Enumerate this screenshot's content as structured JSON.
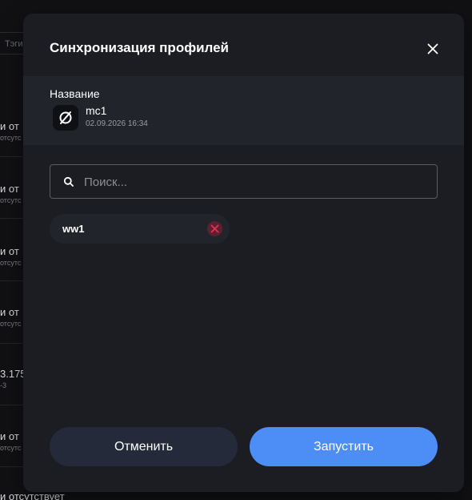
{
  "background": {
    "tags_label": "Тэги",
    "rows": [
      {
        "title": "и от",
        "subtitle": "отсутс"
      },
      {
        "title": "и от",
        "subtitle": "отсутс"
      },
      {
        "title": "и от",
        "subtitle": "отсутс"
      },
      {
        "title": "и от",
        "subtitle": "отсутс"
      },
      {
        "title": "3.175.",
        "subtitle": "-3"
      },
      {
        "title": "и от",
        "subtitle": "отсутс"
      }
    ],
    "bottom_text": "и отсутствует"
  },
  "dialog": {
    "title": "Синхронизация профилей",
    "close_icon": "close-icon",
    "column_label": "Название",
    "profile": {
      "name": "mc1",
      "date": "02.09.2026 16:34",
      "icon": "slashed-circle-icon"
    },
    "search": {
      "placeholder": "Поиск...",
      "value": "",
      "icon": "search-icon"
    },
    "selected": [
      {
        "label": "ww1",
        "remove_icon": "remove-icon"
      }
    ],
    "buttons": {
      "cancel": "Отменить",
      "run": "Запустить"
    }
  },
  "colors": {
    "accent": "#4c8ef5",
    "dialog_bg": "#1c1d22",
    "cancel_bg": "#242a3a",
    "remove_red": "#e0344f"
  }
}
